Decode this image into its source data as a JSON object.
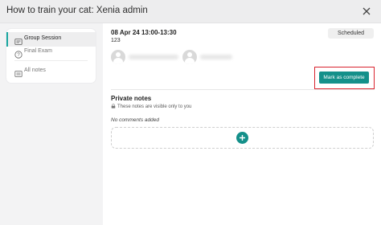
{
  "window": {
    "title": "How to train your cat: Xenia admin"
  },
  "sidebar": {
    "items": [
      {
        "label": "Group Session",
        "active": true
      },
      {
        "label": "Final Exam",
        "active": false
      },
      {
        "label": "All notes",
        "active": false
      }
    ]
  },
  "session": {
    "date_time": "08 Apr 24 13:00-13:30",
    "number": "123",
    "status": "Scheduled",
    "mark_complete_label": "Mark as complete"
  },
  "notes": {
    "title": "Private notes",
    "hint": "These notes are visible only to you",
    "empty": "No comments added"
  },
  "colors": {
    "accent": "#14908a",
    "highlight_outline": "#d9232e"
  },
  "icons": {
    "close": "close-icon",
    "group": "group-session-icon",
    "exam": "help-circle-icon",
    "notes": "notes-icon",
    "lock": "lock-icon",
    "add": "plus-icon"
  }
}
